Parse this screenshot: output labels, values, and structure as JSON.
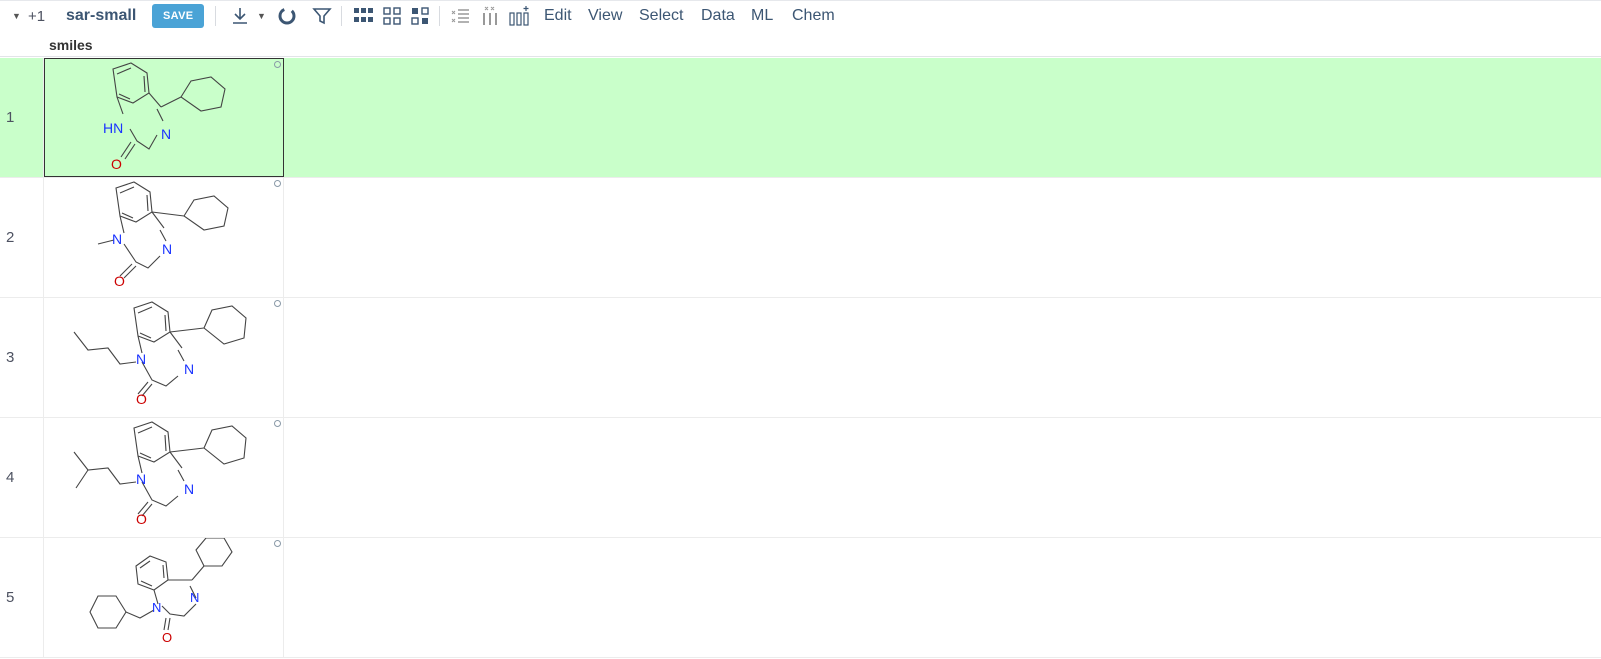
{
  "toolbar": {
    "badge": "+1",
    "project_name": "sar-small",
    "save_label": "SAVE",
    "icons": [
      "caret-down-icon",
      "download-icon",
      "refresh-icon",
      "filter-icon",
      "grid-layout-icon",
      "grid-layout-outline-icon",
      "grid-layout-alt-icon",
      "remove-rows-icon",
      "remove-columns-icon",
      "add-columns-icon"
    ],
    "menus": [
      "Edit",
      "View",
      "Select",
      "Data",
      "ML",
      "Chem"
    ]
  },
  "grid": {
    "column_header": "smiles",
    "selected_row": 1,
    "rows": [
      {
        "num": "1",
        "molecule": "benzodiazepinone-NH-cyclohexyl"
      },
      {
        "num": "2",
        "molecule": "benzodiazepinone-N-methyl-cyclohexyl"
      },
      {
        "num": "3",
        "molecule": "benzodiazepinone-N-butyl-cyclohexyl"
      },
      {
        "num": "4",
        "molecule": "benzodiazepinone-N-isopentyl-cyclohexyl"
      },
      {
        "num": "5",
        "molecule": "benzodiazepinone-N-cyclohexylmethyl-cyclohexyl"
      }
    ],
    "atom_labels": {
      "nh": "HN",
      "n": "N",
      "o": "O"
    },
    "colors": {
      "selected_row": "#c9ffca",
      "nitrogen": "#1a33ff",
      "oxygen": "#cc0000",
      "bond": "#444444",
      "accent": "#4aa3d6"
    }
  }
}
